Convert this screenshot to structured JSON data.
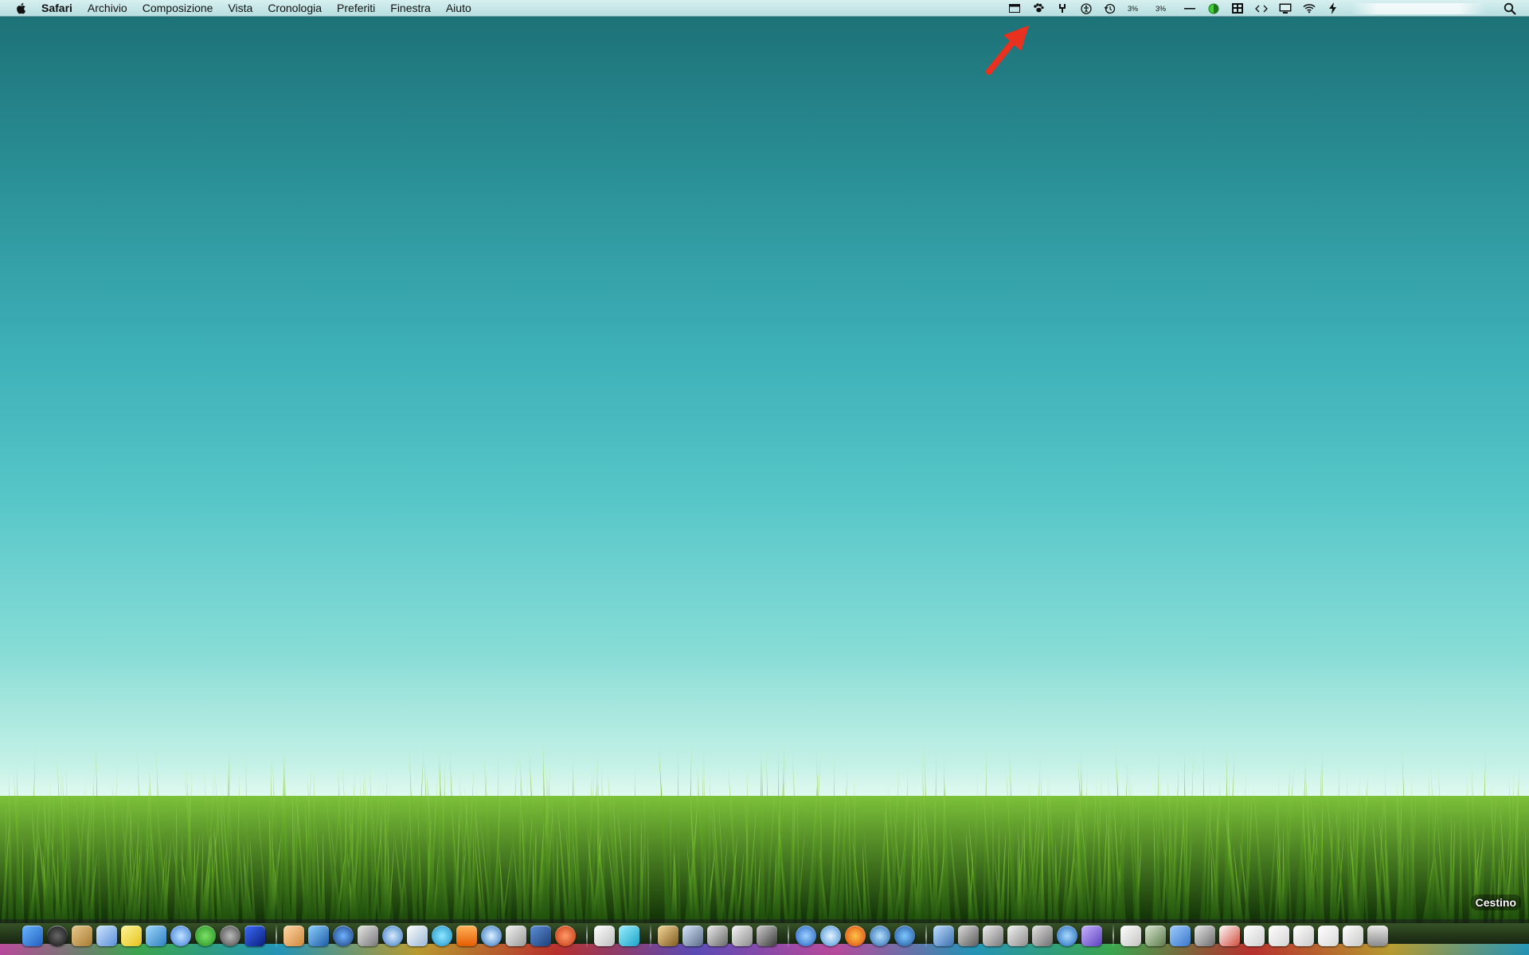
{
  "menubar": {
    "app_name": "Safari",
    "menus": [
      "Archivio",
      "Composizione",
      "Vista",
      "Cronologia",
      "Preferiti",
      "Finestra",
      "Aiuto"
    ],
    "status": {
      "cpu_1": "3%",
      "cpu_2": "3%"
    }
  },
  "dock": {
    "tooltip": "Cestino"
  }
}
